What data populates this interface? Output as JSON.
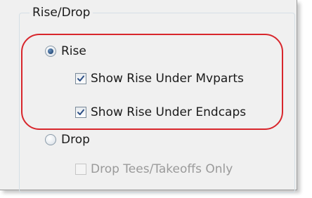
{
  "group": {
    "title": "Rise/Drop"
  },
  "options": {
    "rise_label": "Rise",
    "rise_selected": true,
    "show_rise_under_mvparts_label": "Show Rise Under Mvparts",
    "show_rise_under_mvparts_checked": true,
    "show_rise_under_endcaps_label": "Show Rise Under Endcaps",
    "show_rise_under_endcaps_checked": true,
    "drop_label": "Drop",
    "drop_selected": false,
    "drop_tees_takeoffs_only_label": "Drop Tees/Takeoffs Only",
    "drop_tees_takeoffs_only_checked": false,
    "drop_tees_takeoffs_only_enabled": false
  },
  "colors": {
    "highlight": "#d8262c",
    "panel_background": "#f0f0f0",
    "disabled_text": "#9a9a9a"
  }
}
